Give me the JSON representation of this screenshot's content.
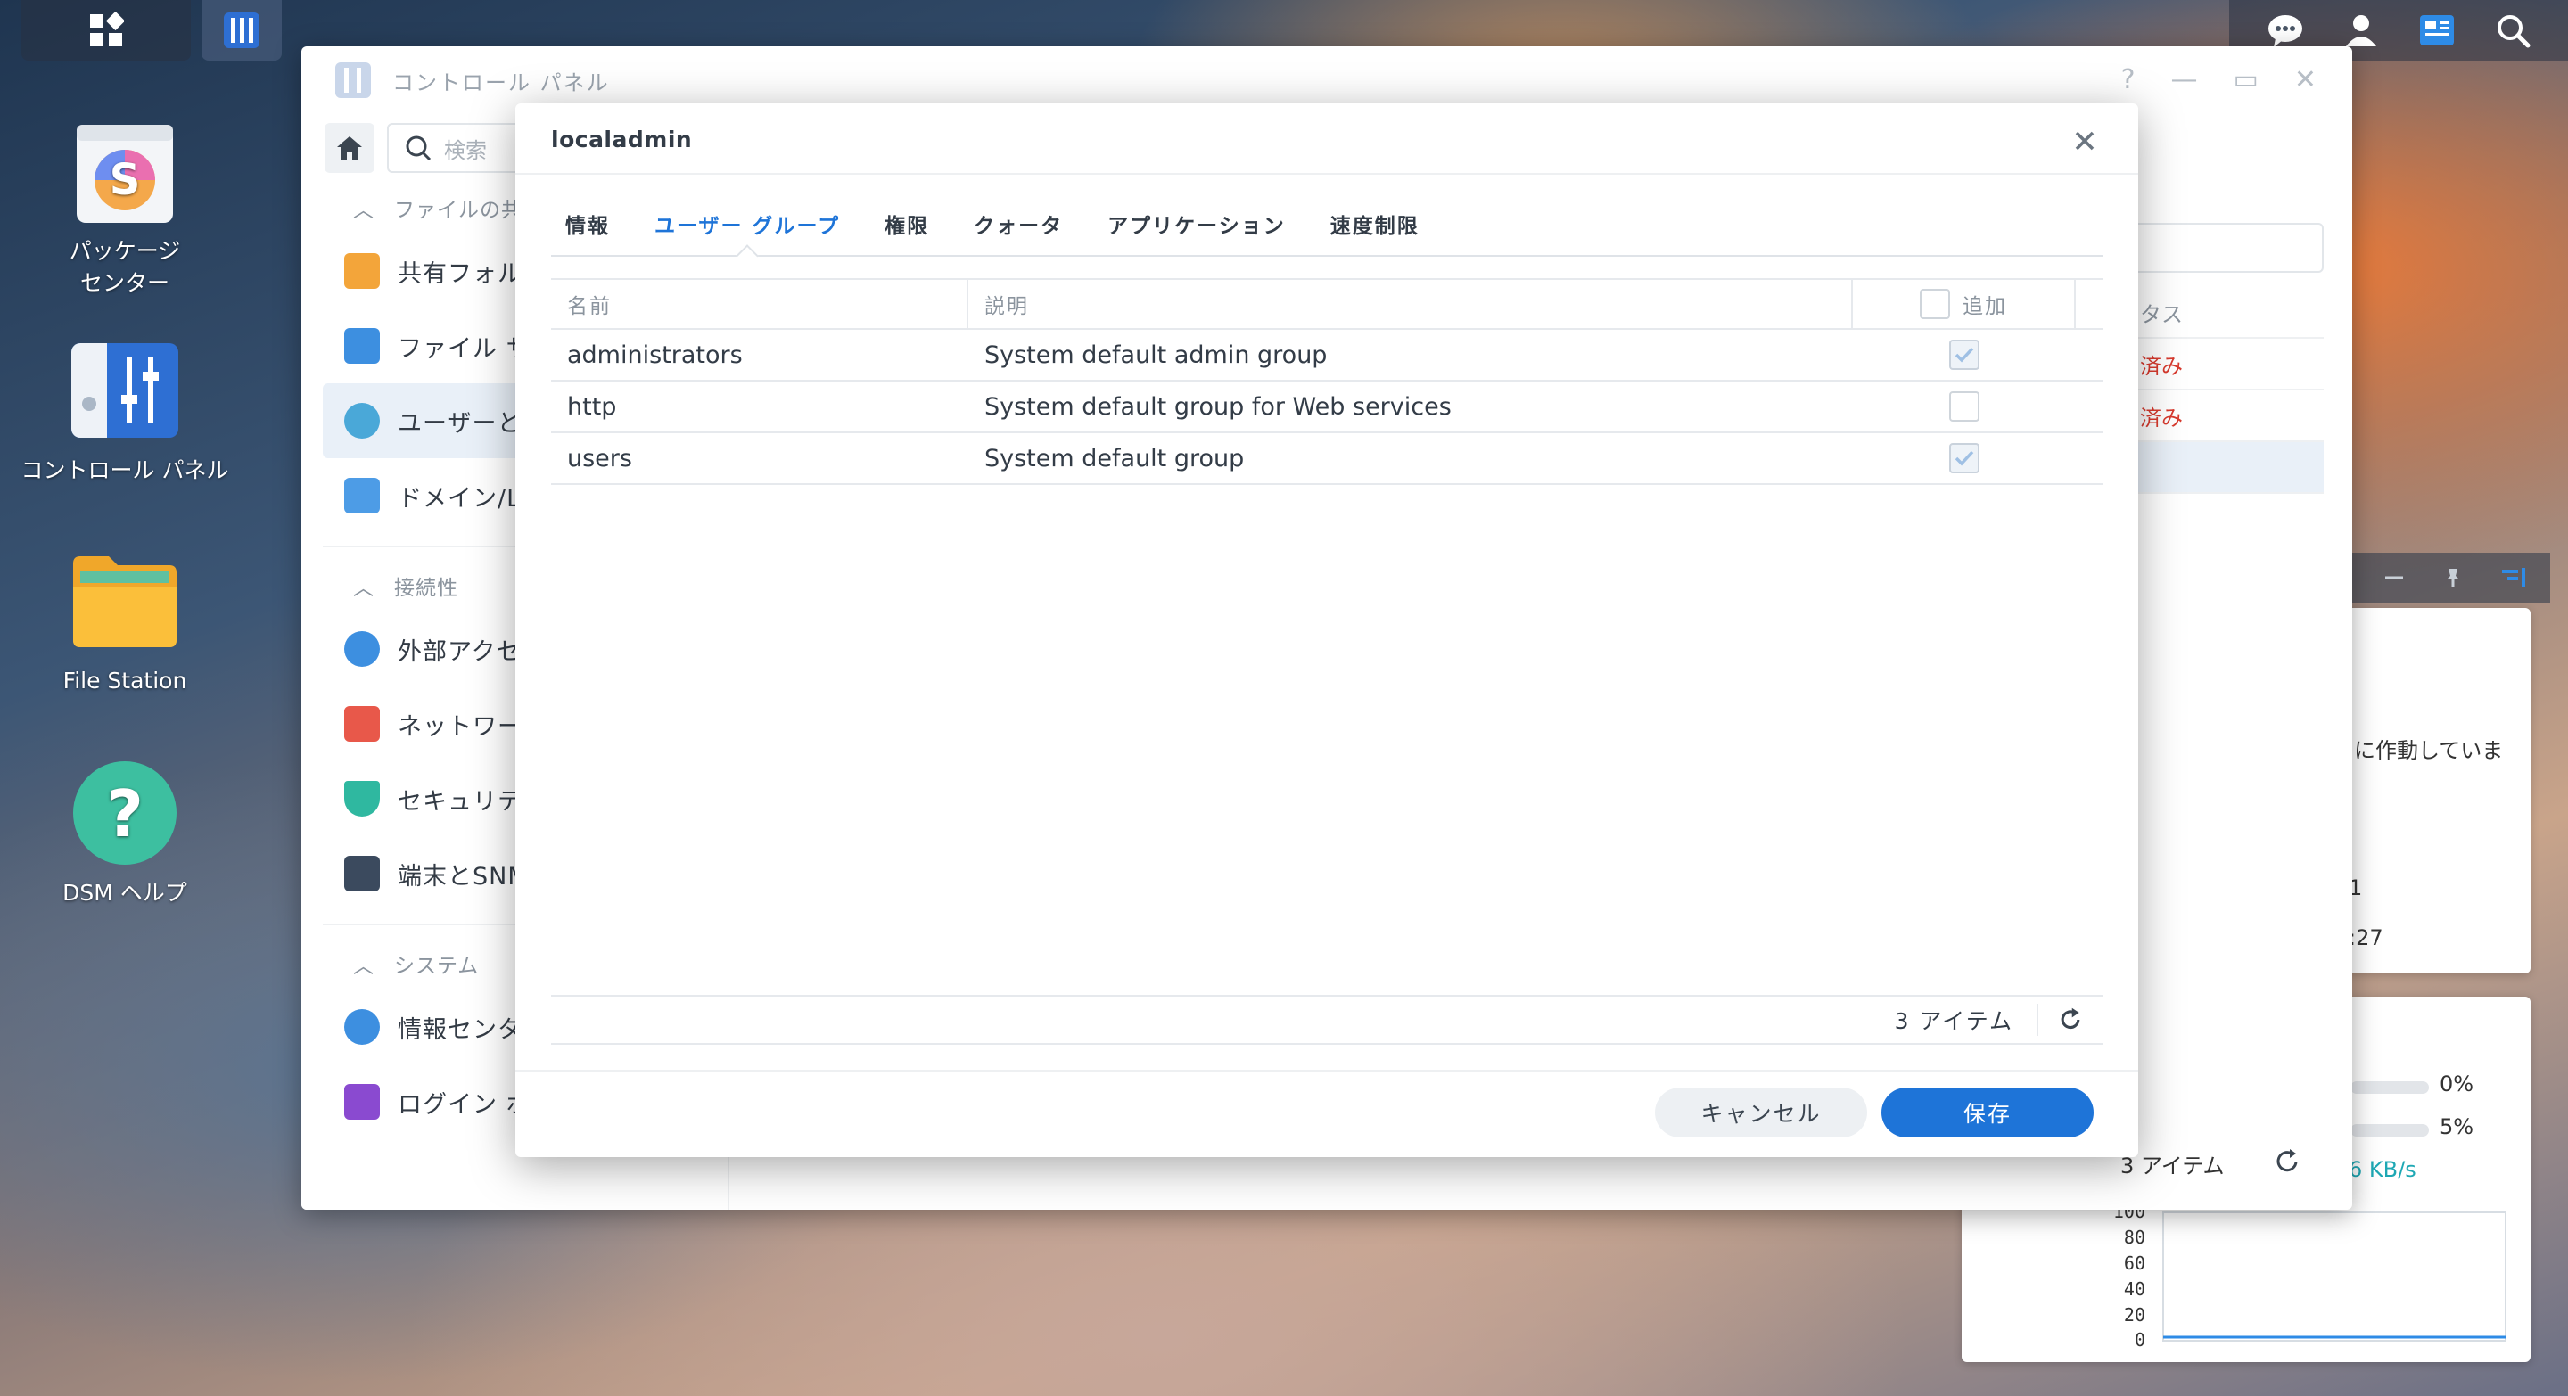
{
  "desktop": {
    "icons": [
      {
        "label_line1": "パッケージ",
        "label_line2": "センター"
      },
      {
        "label_line1": "コントロール パネル",
        "label_line2": ""
      },
      {
        "label_line1": "File Station",
        "label_line2": ""
      },
      {
        "label_line1": "DSM ヘルプ",
        "label_line2": ""
      }
    ]
  },
  "control_panel": {
    "title": "コントロール パネル",
    "search_placeholder": "検索",
    "sections": {
      "file_sharing": "ファイルの共",
      "connectivity": "接続性",
      "system": "システム"
    },
    "items": {
      "shared_folder": "共有フォル",
      "file_services": "ファイル サ",
      "user_group": "ユーザーと",
      "domain": "ドメイン/L",
      "external_access": "外部アクセ",
      "network": "ネットワー",
      "security": "セキュリテ",
      "terminal": "端末とSNM",
      "info_center": "情報センタ",
      "login_portal": "ログイン ポ"
    },
    "background": {
      "status_header": "タス",
      "status_1": "済み",
      "status_2": "済み",
      "footer_count": "3 アイテム"
    }
  },
  "widgets": {
    "system_text": "に作動していま",
    "line_1": "1",
    "line_2": ":27",
    "cpu_pct": "0%",
    "ram_pct": "5%",
    "net_speed": "6 KB/s",
    "chart_ticks": [
      "100",
      "80",
      "60",
      "40",
      "20",
      "0"
    ],
    "colors": {
      "link": "#1ea8b4",
      "red": "#d83a2e"
    }
  },
  "dialog": {
    "title": "localadmin",
    "tabs": [
      "情報",
      "ユーザー グループ",
      "権限",
      "クォータ",
      "アプリケーション",
      "速度制限"
    ],
    "active_tab": "ユーザー グループ",
    "columns": {
      "name": "名前",
      "description": "説明",
      "add": "追加"
    },
    "rows": [
      {
        "name": "administrators",
        "description": "System default admin group",
        "checked": true
      },
      {
        "name": "http",
        "description": "System default group for Web services",
        "checked": false
      },
      {
        "name": "users",
        "description": "System default group",
        "checked": true
      }
    ],
    "item_count": "3 アイテム",
    "buttons": {
      "cancel": "キャンセル",
      "save": "保存"
    },
    "accent_color": "#1e74d8"
  }
}
